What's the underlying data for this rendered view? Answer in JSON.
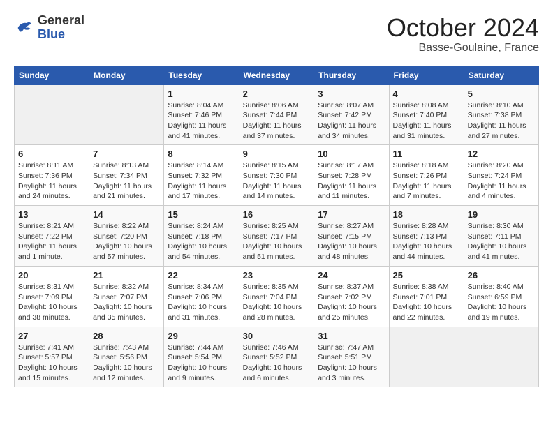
{
  "header": {
    "logo_general": "General",
    "logo_blue": "Blue",
    "month": "October 2024",
    "location": "Basse-Goulaine, France"
  },
  "days_of_week": [
    "Sunday",
    "Monday",
    "Tuesday",
    "Wednesday",
    "Thursday",
    "Friday",
    "Saturday"
  ],
  "weeks": [
    [
      {
        "day": "",
        "info": ""
      },
      {
        "day": "",
        "info": ""
      },
      {
        "day": "1",
        "info": "Sunrise: 8:04 AM\nSunset: 7:46 PM\nDaylight: 11 hours and 41 minutes."
      },
      {
        "day": "2",
        "info": "Sunrise: 8:06 AM\nSunset: 7:44 PM\nDaylight: 11 hours and 37 minutes."
      },
      {
        "day": "3",
        "info": "Sunrise: 8:07 AM\nSunset: 7:42 PM\nDaylight: 11 hours and 34 minutes."
      },
      {
        "day": "4",
        "info": "Sunrise: 8:08 AM\nSunset: 7:40 PM\nDaylight: 11 hours and 31 minutes."
      },
      {
        "day": "5",
        "info": "Sunrise: 8:10 AM\nSunset: 7:38 PM\nDaylight: 11 hours and 27 minutes."
      }
    ],
    [
      {
        "day": "6",
        "info": "Sunrise: 8:11 AM\nSunset: 7:36 PM\nDaylight: 11 hours and 24 minutes."
      },
      {
        "day": "7",
        "info": "Sunrise: 8:13 AM\nSunset: 7:34 PM\nDaylight: 11 hours and 21 minutes."
      },
      {
        "day": "8",
        "info": "Sunrise: 8:14 AM\nSunset: 7:32 PM\nDaylight: 11 hours and 17 minutes."
      },
      {
        "day": "9",
        "info": "Sunrise: 8:15 AM\nSunset: 7:30 PM\nDaylight: 11 hours and 14 minutes."
      },
      {
        "day": "10",
        "info": "Sunrise: 8:17 AM\nSunset: 7:28 PM\nDaylight: 11 hours and 11 minutes."
      },
      {
        "day": "11",
        "info": "Sunrise: 8:18 AM\nSunset: 7:26 PM\nDaylight: 11 hours and 7 minutes."
      },
      {
        "day": "12",
        "info": "Sunrise: 8:20 AM\nSunset: 7:24 PM\nDaylight: 11 hours and 4 minutes."
      }
    ],
    [
      {
        "day": "13",
        "info": "Sunrise: 8:21 AM\nSunset: 7:22 PM\nDaylight: 11 hours and 1 minute."
      },
      {
        "day": "14",
        "info": "Sunrise: 8:22 AM\nSunset: 7:20 PM\nDaylight: 10 hours and 57 minutes."
      },
      {
        "day": "15",
        "info": "Sunrise: 8:24 AM\nSunset: 7:18 PM\nDaylight: 10 hours and 54 minutes."
      },
      {
        "day": "16",
        "info": "Sunrise: 8:25 AM\nSunset: 7:17 PM\nDaylight: 10 hours and 51 minutes."
      },
      {
        "day": "17",
        "info": "Sunrise: 8:27 AM\nSunset: 7:15 PM\nDaylight: 10 hours and 48 minutes."
      },
      {
        "day": "18",
        "info": "Sunrise: 8:28 AM\nSunset: 7:13 PM\nDaylight: 10 hours and 44 minutes."
      },
      {
        "day": "19",
        "info": "Sunrise: 8:30 AM\nSunset: 7:11 PM\nDaylight: 10 hours and 41 minutes."
      }
    ],
    [
      {
        "day": "20",
        "info": "Sunrise: 8:31 AM\nSunset: 7:09 PM\nDaylight: 10 hours and 38 minutes."
      },
      {
        "day": "21",
        "info": "Sunrise: 8:32 AM\nSunset: 7:07 PM\nDaylight: 10 hours and 35 minutes."
      },
      {
        "day": "22",
        "info": "Sunrise: 8:34 AM\nSunset: 7:06 PM\nDaylight: 10 hours and 31 minutes."
      },
      {
        "day": "23",
        "info": "Sunrise: 8:35 AM\nSunset: 7:04 PM\nDaylight: 10 hours and 28 minutes."
      },
      {
        "day": "24",
        "info": "Sunrise: 8:37 AM\nSunset: 7:02 PM\nDaylight: 10 hours and 25 minutes."
      },
      {
        "day": "25",
        "info": "Sunrise: 8:38 AM\nSunset: 7:01 PM\nDaylight: 10 hours and 22 minutes."
      },
      {
        "day": "26",
        "info": "Sunrise: 8:40 AM\nSunset: 6:59 PM\nDaylight: 10 hours and 19 minutes."
      }
    ],
    [
      {
        "day": "27",
        "info": "Sunrise: 7:41 AM\nSunset: 5:57 PM\nDaylight: 10 hours and 15 minutes."
      },
      {
        "day": "28",
        "info": "Sunrise: 7:43 AM\nSunset: 5:56 PM\nDaylight: 10 hours and 12 minutes."
      },
      {
        "day": "29",
        "info": "Sunrise: 7:44 AM\nSunset: 5:54 PM\nDaylight: 10 hours and 9 minutes."
      },
      {
        "day": "30",
        "info": "Sunrise: 7:46 AM\nSunset: 5:52 PM\nDaylight: 10 hours and 6 minutes."
      },
      {
        "day": "31",
        "info": "Sunrise: 7:47 AM\nSunset: 5:51 PM\nDaylight: 10 hours and 3 minutes."
      },
      {
        "day": "",
        "info": ""
      },
      {
        "day": "",
        "info": ""
      }
    ]
  ]
}
